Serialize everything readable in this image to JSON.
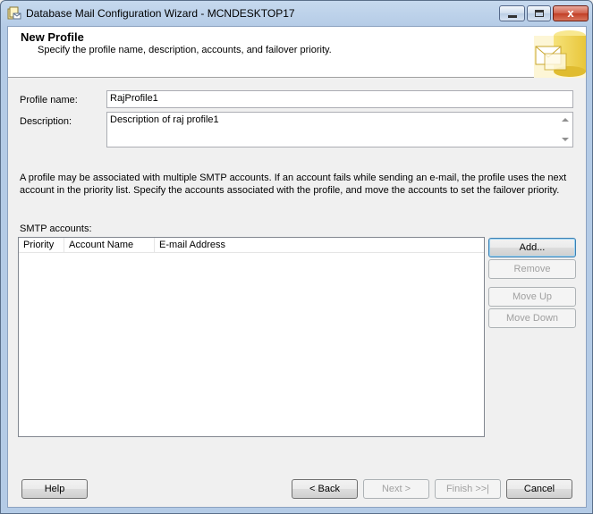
{
  "window": {
    "title": "Database Mail Configuration Wizard - MCNDESKTOP17",
    "controls": {
      "minimize": "",
      "maximize": "",
      "close": "x"
    }
  },
  "header": {
    "title": "New Profile",
    "subtitle": "Specify the profile name, description, accounts, and failover priority."
  },
  "form": {
    "profile_name_label": "Profile name:",
    "profile_name_value": "RajProfile1",
    "description_label": "Description:",
    "description_value": "Description of raj profile1"
  },
  "info": {
    "line1": "A profile may be associated with multiple SMTP accounts. If an account fails while sending an e-mail, the profile uses the next",
    "line2": "account in the priority list. Specify the accounts associated with the profile, and move the accounts to set the failover priority."
  },
  "smtp": {
    "label": "SMTP accounts:",
    "columns": [
      "Priority",
      "Account Name",
      "E-mail Address"
    ],
    "rows": []
  },
  "side_buttons": {
    "add": "Add...",
    "remove": "Remove",
    "move_up": "Move Up",
    "move_down": "Move Down"
  },
  "footer": {
    "help": "Help",
    "back": "< Back",
    "next": "Next >",
    "finish": "Finish >>|",
    "cancel": "Cancel"
  }
}
